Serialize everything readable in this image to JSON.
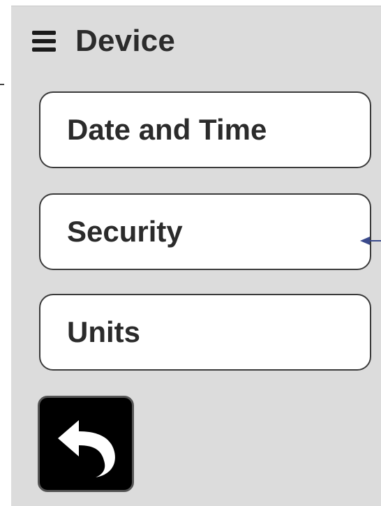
{
  "header": {
    "menu_icon": "hamburger-menu-icon",
    "title": "Device"
  },
  "menu": {
    "items": [
      {
        "label": "Date and Time"
      },
      {
        "label": "Security"
      },
      {
        "label": "Units"
      }
    ]
  },
  "back": {
    "icon": "undo-arrow-icon"
  },
  "colors": {
    "panel_background": "#dcdcdc",
    "button_background": "#ffffff",
    "button_border": "#3a3a3a",
    "back_button_background": "#000000",
    "pointer_arrow": "#3a4a8c"
  }
}
